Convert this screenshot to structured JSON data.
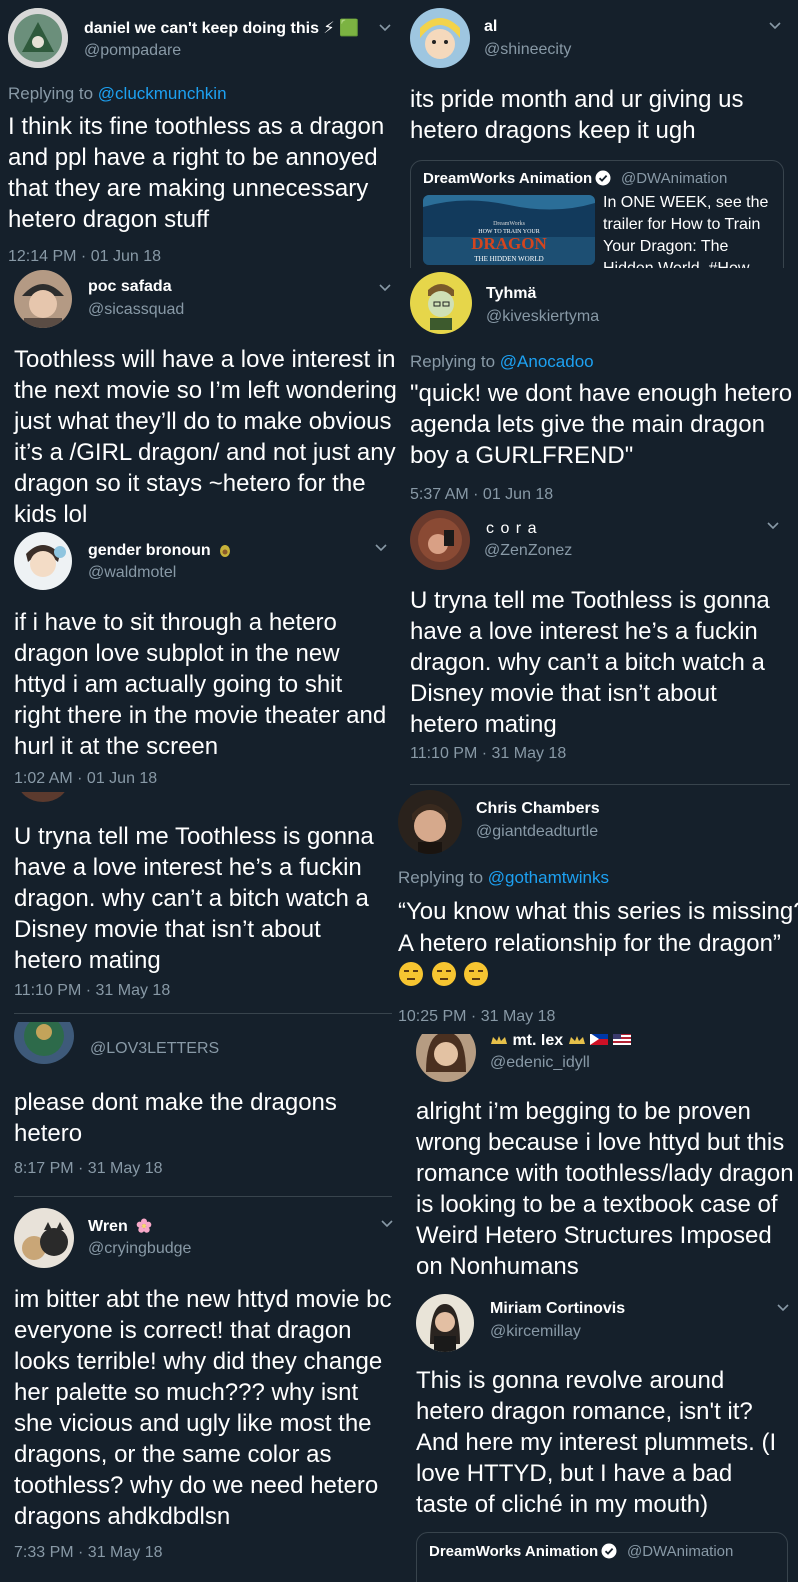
{
  "tweets": [
    {
      "name": "daniel we can't keep doing this",
      "handle": "@pompadare",
      "reply_prefix": "Replying to ",
      "reply_to": "@cluckmunchkin",
      "text": "I think its fine toothless as a dragon and ppl have a right to be annoyed that they are making unnecessary hetero dragon stuff",
      "time": "12:14 PM · 01 Jun 18",
      "name_emoji": "⚡ 🟩"
    },
    {
      "name": "al",
      "handle": "@shineecity",
      "text": "its pride month and ur giving us hetero dragons keep it ugh",
      "quote": {
        "name": "DreamWorks Animation",
        "handle": "@DWAnimation",
        "text": "In ONE WEEK, see the trailer for How to Train Your Dragon: The Hidden World. #How",
        "poster_top": "DreamWorks",
        "poster_mid": "HOW TO TRAIN YOUR",
        "poster_title": "DRAGON",
        "poster_sub": "THE HIDDEN WORLD"
      }
    },
    {
      "name": "poc safada",
      "handle": "@sicassquad",
      "text": "Toothless will have a love interest in the next movie so I’m left wondering just what they’ll do to make obvious it’s a /GIRL dragon/ and not just any dragon so it stays ~hetero for the kids lol"
    },
    {
      "name": "Tyhmä",
      "handle": "@kiveskiertyma",
      "reply_prefix": "Replying to ",
      "reply_to": "@Anocadoo",
      "text": "\"quick! we dont have enough hetero agenda lets give the main dragon boy a GURLFREND\"",
      "time": "5:37 AM · 01 Jun 18"
    },
    {
      "name": "gender bronoun",
      "handle": "@waldmotel",
      "text": "if i have to sit through a hetero dragon love subplot in the new httyd i am actually going to shit right there in the movie theater and hurl it at the screen",
      "time": "1:02 AM · 01 Jun 18"
    },
    {
      "name": "c o r a",
      "handle": "@ZenZonez",
      "text": "U tryna tell me Toothless is gonna have a love interest he’s a fuckin dragon. why can’t a bitch watch a Disney movie that isn’t about hetero mating",
      "time": "11:10 PM · 31 May 18"
    },
    {
      "text": "U tryna tell me Toothless is gonna have a love interest he’s a fuckin dragon. why can’t a bitch watch a Disney movie that isn’t about hetero mating",
      "time": "11:10 PM · 31 May 18"
    },
    {
      "name": "Chris Chambers",
      "handle": "@giantdeadturtle",
      "reply_prefix": "Replying to ",
      "reply_to": "@gothamtwinks",
      "text": "“You know what this series is missing? A hetero relationship for the dragon”",
      "time": "10:25 PM · 31 May 18"
    },
    {
      "handle": "@LOV3LETTERS",
      "text": "please dont make the dragons hetero",
      "time": "8:17 PM · 31 May 18"
    },
    {
      "name": "mt. lex",
      "handle": "@edenic_idyll",
      "text": "alright i’m begging to be proven wrong because i love httyd but this romance with toothless/lady dragon is looking to be a textbook case of Weird Hetero Structures Imposed on Nonhumans"
    },
    {
      "name": "Wren",
      "handle": "@cryingbudge",
      "text": "im bitter abt the new httyd movie bc everyone is correct! that dragon looks terrible! why did they change her palette so much??? why isnt she vicious and ugly like most the dragons, or the same color as toothless? why do we need hetero dragons ahdkdbdlsn",
      "time": "7:33 PM · 31 May 18"
    },
    {
      "name": "Miriam Cortinovis",
      "handle": "@kircemillay",
      "text": "This is gonna revolve around hetero dragon romance, isn't it? And here my interest plummets. (I love HTTYD, but I have a bad taste of cliché in my mouth)",
      "quote": {
        "name": "DreamWorks Animation",
        "handle": "@DWAnimation"
      }
    }
  ],
  "colors": {
    "background": "#15202b",
    "text": "#ffffff",
    "secondary": "#8899a6",
    "link": "#1da1f2",
    "divider": "#38444d"
  }
}
